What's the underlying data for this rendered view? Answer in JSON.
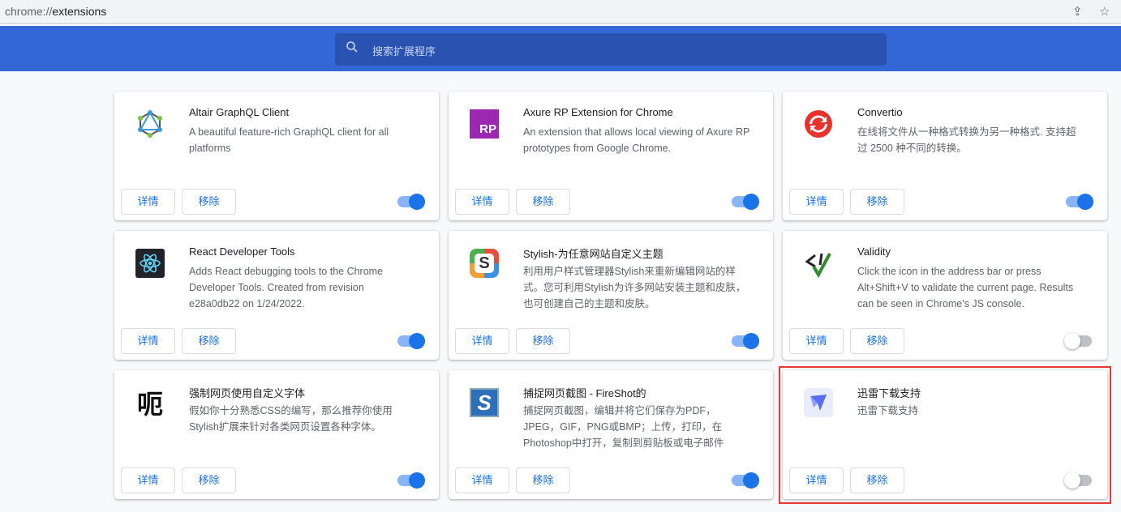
{
  "address_bar": {
    "scheme": "chrome://",
    "path": "extensions"
  },
  "search": {
    "placeholder": "搜索扩展程序"
  },
  "buttons": {
    "details": "详情",
    "remove": "移除"
  },
  "extensions": [
    {
      "name": "Altair GraphQL Client",
      "description": "A beautiful feature-rich GraphQL client for all platforms",
      "enabled": true,
      "icon": "graphql-icon"
    },
    {
      "name": "Axure RP Extension for Chrome",
      "description": "An extension that allows local viewing of Axure RP prototypes from Google Chrome.",
      "enabled": true,
      "icon": "axure-rp-icon",
      "icon_text": "RP"
    },
    {
      "name": "Convertio",
      "description": "在线将文件从一种格式转换为另一种格式. 支持超过 2500 种不同的转换。",
      "enabled": true,
      "icon": "convertio-icon"
    },
    {
      "name": "React Developer Tools",
      "description": "Adds React debugging tools to the Chrome Developer Tools. Created from revision e28a0db22 on 1/24/2022.",
      "enabled": true,
      "icon": "react-icon"
    },
    {
      "name": "Stylish-为任意网站自定义主题",
      "description": "利用用户样式管理器Stylish来重新编辑网站的样式。您可利用Stylish为许多网站安装主题和皮肤，也可创建自己的主题和皮肤。",
      "enabled": true,
      "icon": "stylish-icon",
      "icon_text": "S"
    },
    {
      "name": "Validity",
      "description": "Click the icon in the address bar or press Alt+Shift+V to validate the current page. Results can be seen in Chrome's JS console.",
      "enabled": false,
      "icon": "validity-icon"
    },
    {
      "name": "强制网页使用自定义字体",
      "description": "假如你十分熟悉CSS的编写，那么推荐你使用Stylish扩展来针对各类网页设置各种字体。",
      "enabled": true,
      "icon": "font-icon",
      "icon_text": "呃"
    },
    {
      "name": "捕捉网页截图 - FireShot的",
      "description": "捕捉网页截图，编辑并将它们保存为PDF，JPEG，GIF，PNG或BMP；上传，打印，在Photoshop中打开，复制到剪贴板或电子邮件",
      "enabled": true,
      "icon": "fireshot-icon",
      "icon_text": "S"
    },
    {
      "name": "迅雷下载支持",
      "description": "迅雷下载支持",
      "enabled": false,
      "icon": "thunder-icon"
    }
  ]
}
